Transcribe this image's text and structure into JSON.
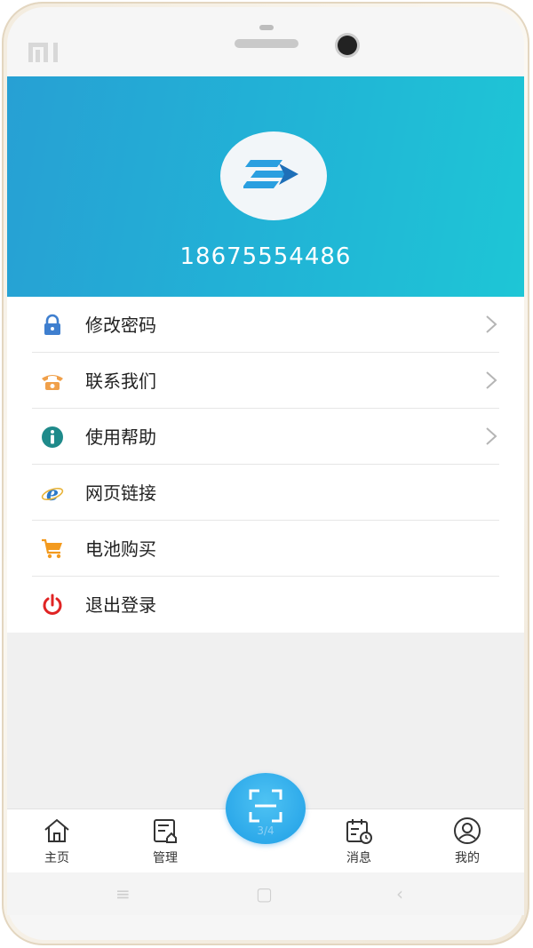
{
  "device": {
    "brand_logo": "MI"
  },
  "profile": {
    "phone_number": "18675554486",
    "avatar_icon": "arrow-logo-icon"
  },
  "menu": {
    "items": [
      {
        "label": "修改密码",
        "icon": "lock-icon",
        "icon_color": "#3f7fcf",
        "has_chevron": true
      },
      {
        "label": "联系我们",
        "icon": "telephone-icon",
        "icon_color": "#f0a04a",
        "has_chevron": true
      },
      {
        "label": "使用帮助",
        "icon": "info-icon",
        "icon_color": "#1f8a8a",
        "has_chevron": true
      },
      {
        "label": "网页链接",
        "icon": "browser-e-icon",
        "icon_color": "#2b78c8",
        "has_chevron": false
      },
      {
        "label": "电池购买",
        "icon": "cart-icon",
        "icon_color": "#f39a1e",
        "has_chevron": false
      },
      {
        "label": "退出登录",
        "icon": "power-icon",
        "icon_color": "#e02424",
        "has_chevron": false
      }
    ]
  },
  "tabbar": {
    "tabs": [
      {
        "label": "主页",
        "icon": "home-icon"
      },
      {
        "label": "管理",
        "icon": "manage-icon"
      },
      {
        "label": "消息",
        "icon": "message-calendar-icon"
      },
      {
        "label": "我的",
        "icon": "user-icon"
      }
    ],
    "scan": {
      "icon": "scan-icon",
      "page_indicator": "3/4"
    }
  },
  "colors": {
    "header_start": "#27a0d4",
    "header_end": "#1ec6d6",
    "scan_button": "#1e9ee6"
  }
}
